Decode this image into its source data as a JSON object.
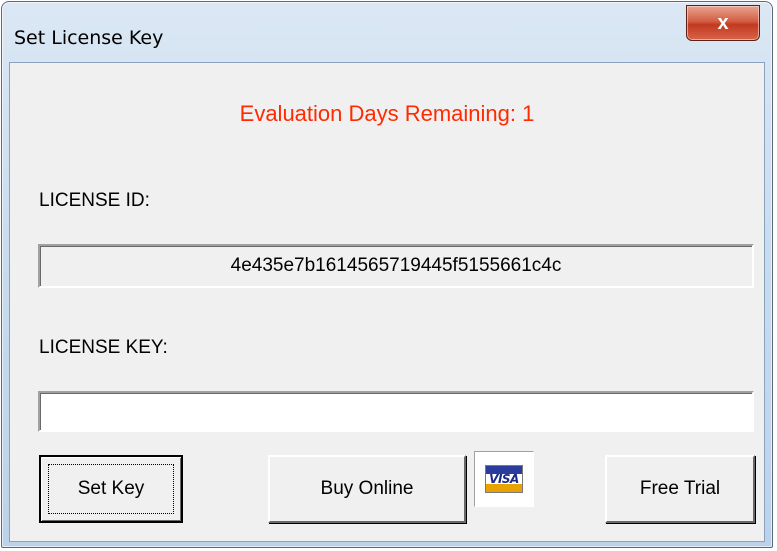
{
  "window": {
    "title": "Set License Key",
    "close_glyph": "x"
  },
  "evaluation": {
    "text": "Evaluation Days Remaining: 1",
    "color": "#ff2a00"
  },
  "license_id": {
    "label": "LICENSE ID:",
    "value": "4e435e7b1614565719445f5155661c4c"
  },
  "license_key": {
    "label": "LICENSE KEY:",
    "value": ""
  },
  "buttons": {
    "set_key": "Set Key",
    "buy_online": "Buy Online",
    "free_trial": "Free Trial"
  },
  "visa": {
    "text": "VISA",
    "icon": "visa-card-icon"
  }
}
